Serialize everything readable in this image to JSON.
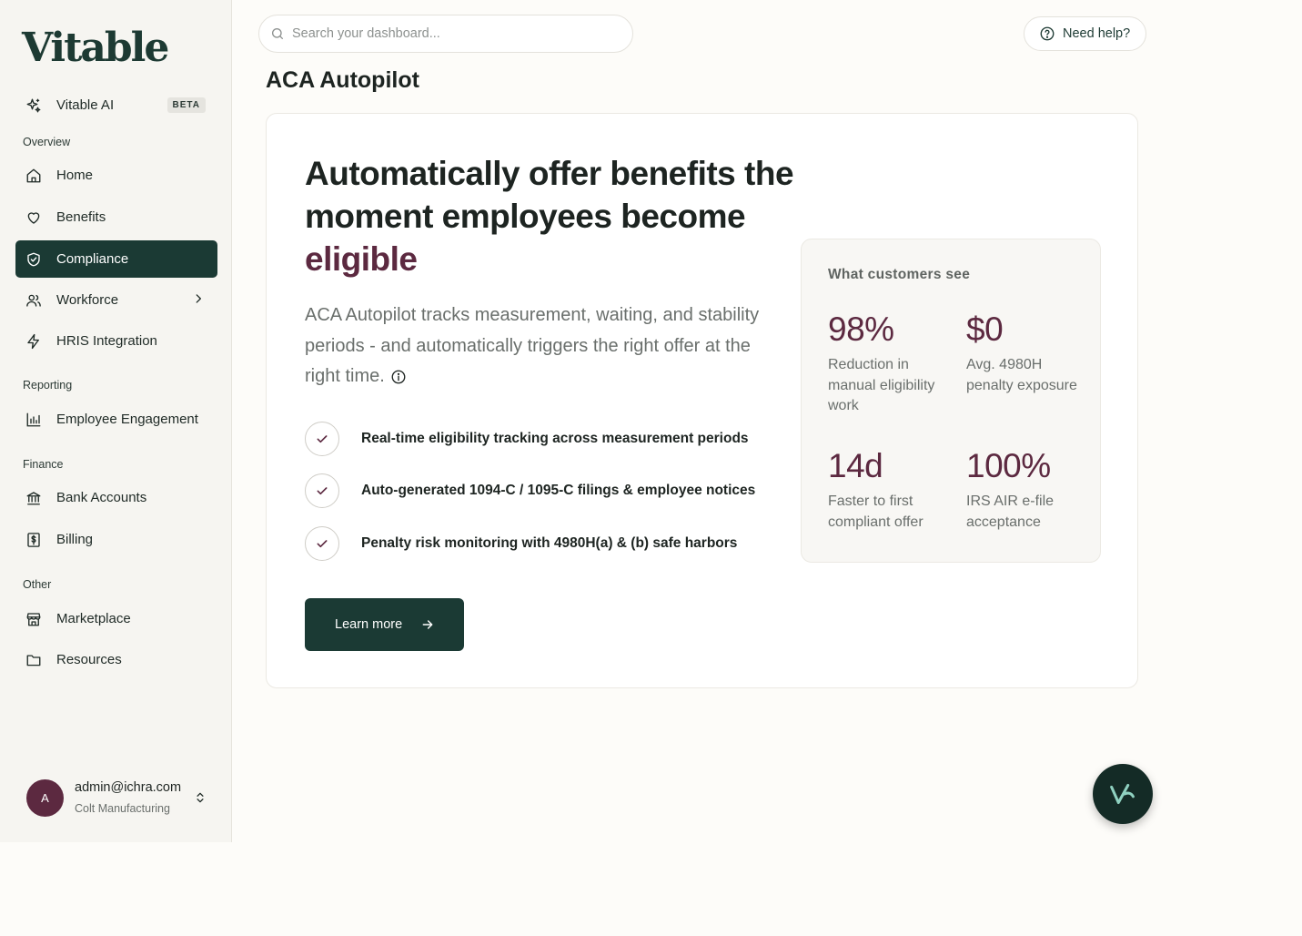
{
  "brand": {
    "logo_text": "Vitable"
  },
  "sidebar": {
    "ai": {
      "label": "Vitable AI",
      "badge": "BETA"
    },
    "sections": {
      "overview": "Overview",
      "reporting": "Reporting",
      "finance": "Finance",
      "other": "Other"
    },
    "items": {
      "home": "Home",
      "benefits": "Benefits",
      "compliance": "Compliance",
      "workforce": "Workforce",
      "hris": "HRIS Integration",
      "engagement": "Employee Engagement",
      "bank": "Bank Accounts",
      "billing": "Billing",
      "marketplace": "Marketplace",
      "resources": "Resources"
    },
    "active_item": "compliance",
    "user": {
      "initial": "A",
      "email": "admin@ichra.com",
      "org": "Colt Manufacturing"
    }
  },
  "topbar": {
    "search_placeholder": "Search your dashboard...",
    "help_label": "Need help?"
  },
  "page": {
    "title": "ACA Autopilot",
    "headline_main": "Automatically offer benefits the moment employees become ",
    "headline_accent": "eligible",
    "description": "ACA Autopilot tracks measurement, waiting, and stability periods - and automatically triggers the right offer at the right time.",
    "features": [
      "Real-time eligibility tracking across measurement periods",
      "Auto-generated 1094-C / 1095-C filings & employee notices",
      "Penalty risk monitoring with 4980H(a) & (b) safe harbors"
    ],
    "cta_label": "Learn more",
    "stats": {
      "title": "What customers see",
      "items": [
        {
          "value": "98%",
          "label": "Reduction in manual eligibility work"
        },
        {
          "value": "$0",
          "label": "Avg. 4980H penalty exposure"
        },
        {
          "value": "14d",
          "label": "Faster to first compliant offer"
        },
        {
          "value": "100%",
          "label": "IRS AIR e-file acceptance"
        }
      ]
    }
  },
  "colors": {
    "primary": "#1b3a34",
    "accent": "#5c2940",
    "background": "#fdfcf9",
    "sidebar_bg": "#f6f5f1"
  }
}
